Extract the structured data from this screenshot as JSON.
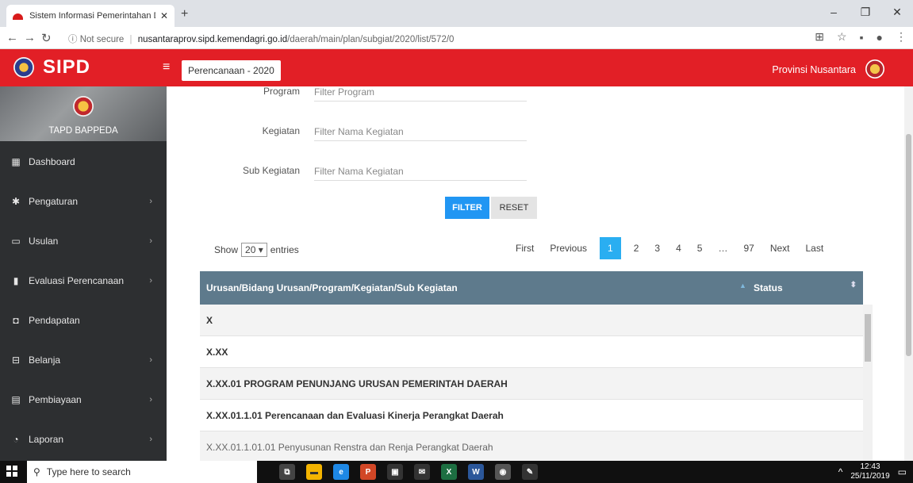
{
  "browser": {
    "tab_title": "Sistem Informasi Pemerintahan D",
    "tab_close": "✕",
    "new_tab": "+",
    "url_status": "Not secure",
    "url_host": "nusantaraprov.sipd.kemendagri.go.id",
    "url_path": "/daerah/main/plan/subgiat/2020/list/572/0",
    "controls": {
      "minimize": "–",
      "restore": "❐",
      "close": "✕"
    }
  },
  "header": {
    "brand": "SIPD",
    "menu_icon": "≡",
    "period": "Perencanaan - 2020",
    "province": "Provinsi Nusantara"
  },
  "sidebar": {
    "unit_name": "TAPD BAPPEDA",
    "items": [
      {
        "label": "Dashboard",
        "icon": "dashboard-icon",
        "glyph": "▦",
        "has_children": false
      },
      {
        "label": "Pengaturan",
        "icon": "gear-icon",
        "glyph": "✱",
        "has_children": true
      },
      {
        "label": "Usulan",
        "icon": "monitor-icon",
        "glyph": "▭",
        "has_children": true
      },
      {
        "label": "Evaluasi Perencanaan",
        "icon": "bookmark-icon",
        "glyph": "▮",
        "has_children": true
      },
      {
        "label": "Pendapatan",
        "icon": "wallet-icon",
        "glyph": "◘",
        "has_children": false
      },
      {
        "label": "Belanja",
        "icon": "cart-icon",
        "glyph": "⊟",
        "has_children": true
      },
      {
        "label": "Pembiayaan",
        "icon": "calculator-icon",
        "glyph": "▤",
        "has_children": true
      },
      {
        "label": "Laporan",
        "icon": "pie-chart-icon",
        "glyph": "◔",
        "has_children": true
      }
    ]
  },
  "filters": {
    "program_label": "Program",
    "program_placeholder": "Filter Program",
    "kegiatan_label": "Kegiatan",
    "kegiatan_placeholder": "Filter Nama Kegiatan",
    "subkegiatan_label": "Sub Kegiatan",
    "subkegiatan_placeholder": "Filter Nama Kegiatan",
    "filter_button": "FILTER",
    "reset_button": "RESET"
  },
  "table_controls": {
    "show_prefix": "Show",
    "entries_value": "20",
    "show_suffix": "entries",
    "pagination": [
      "First",
      "Previous",
      "1",
      "2",
      "3",
      "4",
      "5",
      "…",
      "97",
      "Next",
      "Last"
    ],
    "active_page": "1"
  },
  "table": {
    "columns": [
      "Urusan/Bidang Urusan/Program/Kegiatan/Sub Kegiatan",
      "Status"
    ],
    "rows": [
      {
        "text": "X",
        "style": "bold"
      },
      {
        "text": "X.XX",
        "style": "bold"
      },
      {
        "text": "X.XX.01 PROGRAM PENUNJANG URUSAN PEMERINTAH DAERAH",
        "style": "bold"
      },
      {
        "text": "X.XX.01.1.01 Perencanaan dan Evaluasi Kinerja Perangkat Daerah",
        "style": "bold"
      },
      {
        "text": "X.XX.01.1.01.01 Penyusunan Renstra dan Renja Perangkat Daerah",
        "style": "normal"
      }
    ]
  },
  "taskbar": {
    "search_placeholder": "Type here to search",
    "time": "12:43",
    "date": "25/11/2019"
  }
}
